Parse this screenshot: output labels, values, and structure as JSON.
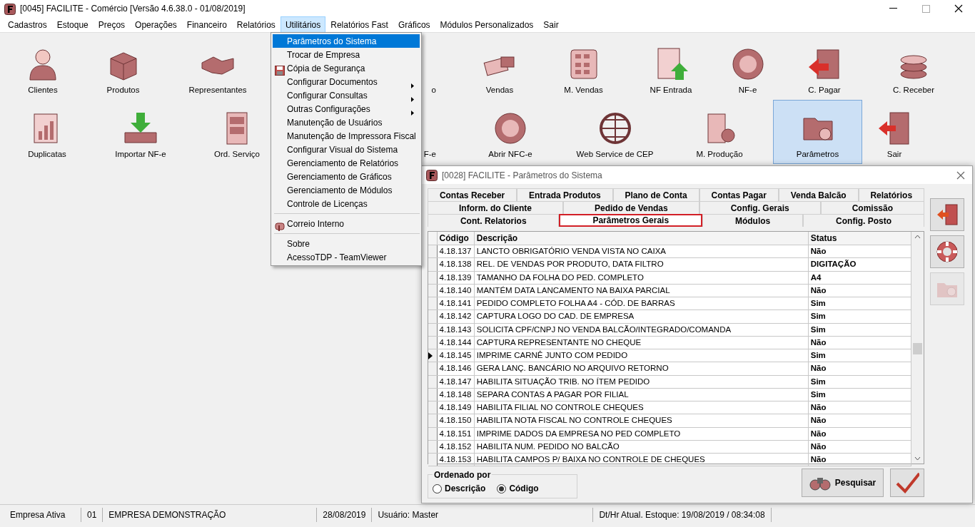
{
  "window": {
    "title": "[0045] FACILITE - Comércio [Versão 4.6.38.0 - 01/08/2019]"
  },
  "menu_bar": [
    {
      "label": "Cadastros",
      "selected": false
    },
    {
      "label": "Estoque",
      "selected": false
    },
    {
      "label": "Preços",
      "selected": false
    },
    {
      "label": "Operações",
      "selected": false
    },
    {
      "label": "Financeiro",
      "selected": false
    },
    {
      "label": "Relatórios",
      "selected": false
    },
    {
      "label": "Utilitários",
      "selected": true
    },
    {
      "label": "Relatórios Fast",
      "selected": false
    },
    {
      "label": "Gráficos",
      "selected": false
    },
    {
      "label": "Módulos Personalizados",
      "selected": false
    },
    {
      "label": "Sair",
      "selected": false
    }
  ],
  "dropdown": [
    {
      "kind": "item",
      "label": "Parâmetros do Sistema",
      "selected": true,
      "submenu": false
    },
    {
      "kind": "item",
      "label": "Trocar de Empresa",
      "selected": false,
      "submenu": false
    },
    {
      "kind": "floppy",
      "label": "Cópia de Segurança",
      "selected": false,
      "submenu": false
    },
    {
      "kind": "item",
      "label": "Configurar Documentos",
      "selected": false,
      "submenu": true
    },
    {
      "kind": "item",
      "label": "Configurar Consultas",
      "selected": false,
      "submenu": true
    },
    {
      "kind": "item",
      "label": "Outras Configurações",
      "selected": false,
      "submenu": true
    },
    {
      "kind": "item",
      "label": "Manutenção de Usuários",
      "selected": false,
      "submenu": false
    },
    {
      "kind": "item",
      "label": "Manutenção de Impressora Fiscal",
      "selected": false,
      "submenu": false
    },
    {
      "kind": "item",
      "label": "Configurar Visual do Sistema",
      "selected": false,
      "submenu": false
    },
    {
      "kind": "item",
      "label": "Gerenciamento de Relatórios",
      "selected": false,
      "submenu": false
    },
    {
      "kind": "item",
      "label": "Gerenciamento de Gráficos",
      "selected": false,
      "submenu": false
    },
    {
      "kind": "item",
      "label": "Gerenciamento de Módulos",
      "selected": false,
      "submenu": false
    },
    {
      "kind": "item",
      "label": "Controle de Licenças",
      "selected": false,
      "submenu": false
    },
    {
      "kind": "separator"
    },
    {
      "kind": "mailbox",
      "label": "Correio Interno",
      "selected": false,
      "submenu": false
    },
    {
      "kind": "separator"
    },
    {
      "kind": "item",
      "label": "Sobre",
      "selected": false,
      "submenu": false
    },
    {
      "kind": "item",
      "label": "AcessoTDP - TeamViewer",
      "selected": false,
      "submenu": false
    }
  ],
  "desktop": [
    [
      {
        "kind": "person",
        "label": "Clientes",
        "selected": false
      },
      {
        "kind": "box",
        "label": "Produtos",
        "selected": false
      },
      {
        "kind": "handshake",
        "label": "Representantes",
        "selected": false
      },
      {
        "kind": "partial",
        "label": "o",
        "selected": false
      },
      {
        "kind": "cash",
        "label": "Vendas",
        "selected": false
      },
      {
        "kind": "calculator",
        "label": "M. Vendas",
        "selected": false
      },
      {
        "kind": "document",
        "label": "NF Entrada",
        "selected": false
      },
      {
        "kind": "badge",
        "label": "NF-e",
        "selected": false
      },
      {
        "kind": "bill",
        "label": "C. Pagar",
        "selected": false
      },
      {
        "kind": "coins",
        "label": "C. Receber",
        "selected": false
      }
    ],
    [
      {
        "kind": "chart",
        "label": "Duplicatas",
        "selected": false
      },
      {
        "kind": "tray",
        "label": "Importar NF-e",
        "selected": false
      },
      {
        "kind": "cabinet",
        "label": "Ord. Serviço",
        "selected": false
      },
      {
        "kind": "partial",
        "label": "F-e",
        "selected": false
      },
      {
        "kind": "badge",
        "label": "Abrir NFC-e",
        "selected": false
      },
      {
        "kind": "globe",
        "label": "Web Service de CEP",
        "selected": false
      },
      {
        "kind": "machine",
        "label": "M. Produção",
        "selected": false
      },
      {
        "kind": "folder",
        "label": "Parâmetros",
        "selected": true
      },
      {
        "kind": "door",
        "label": "Sair",
        "selected": false
      }
    ]
  ],
  "dialog": {
    "title": "[0028] FACILITE - Parâmetros do Sistema",
    "tabs": [
      [
        {
          "label": "Contas Receber",
          "selected": false
        },
        {
          "label": "Entrada Produtos",
          "selected": false
        },
        {
          "label": "Plano de Conta",
          "selected": false
        },
        {
          "label": "Contas Pagar",
          "selected": false
        },
        {
          "label": "Venda Balcão",
          "selected": false
        },
        {
          "label": "Relatórios",
          "selected": false
        }
      ],
      [
        {
          "label": "Inform. do Cliente",
          "selected": false
        },
        {
          "label": "Pedido de Vendas",
          "selected": false
        },
        {
          "label": "Config. Gerais",
          "selected": false
        },
        {
          "label": "Comissão",
          "selected": false
        }
      ],
      [
        {
          "label": "Cont. Relatorios",
          "selected": false
        },
        {
          "label": "Parâmetros Gerais",
          "selected": true
        },
        {
          "label": "Módulos",
          "selected": false
        },
        {
          "label": "Config. Posto",
          "selected": false
        }
      ]
    ],
    "table": {
      "columns": [
        "Código",
        "Descrição",
        "Status"
      ],
      "rows": [
        {
          "code": "4.18.137",
          "description": "LANCTO OBRIGATÓRIO VENDA VISTA NO CAIXA",
          "status": "Não",
          "selected": false
        },
        {
          "code": "4.18.138",
          "description": "REL. DE VENDAS POR PRODUTO, DATA FILTRO",
          "status": "DIGITAÇÃO",
          "selected": false
        },
        {
          "code": "4.18.139",
          "description": "TAMANHO DA FOLHA DO PED. COMPLETO",
          "status": "A4",
          "selected": false
        },
        {
          "code": "4.18.140",
          "description": "MANTÉM DATA LANCAMENTO NA BAIXA PARCIAL",
          "status": "Não",
          "selected": false
        },
        {
          "code": "4.18.141",
          "description": "PEDIDO COMPLETO FOLHA A4 - CÓD. DE BARRAS",
          "status": "Sim",
          "selected": false
        },
        {
          "code": "4.18.142",
          "description": "CAPTURA LOGO DO CAD. DE EMPRESA",
          "status": "Sim",
          "selected": false
        },
        {
          "code": "4.18.143",
          "description": "SOLICITA CPF/CNPJ NO VENDA BALCÃO/INTEGRADO/COMANDA",
          "status": "Sim",
          "selected": false
        },
        {
          "code": "4.18.144",
          "description": "CAPTURA REPRESENTANTE NO CHEQUE",
          "status": "Não",
          "selected": false
        },
        {
          "code": "4.18.145",
          "description": "IMPRIME CARNÊ JUNTO COM PEDIDO",
          "status": "Sim",
          "selected": true
        },
        {
          "code": "4.18.146",
          "description": "GERA LANÇ. BANCÁRIO NO ARQUIVO RETORNO",
          "status": "Não",
          "selected": false
        },
        {
          "code": "4.18.147",
          "description": "HABILITA SITUAÇÃO TRIB. NO ÍTEM PEDIDO",
          "status": "Sim",
          "selected": false
        },
        {
          "code": "4.18.148",
          "description": "SEPARA CONTAS A PAGAR POR FILIAL",
          "status": "Sim",
          "selected": false
        },
        {
          "code": "4.18.149",
          "description": "HABILITA FILIAL NO CONTROLE CHEQUES",
          "status": "Não",
          "selected": false
        },
        {
          "code": "4.18.150",
          "description": "HABILITA NOTA FISCAL NO CONTROLE CHEQUES",
          "status": "Não",
          "selected": false
        },
        {
          "code": "4.18.151",
          "description": "IMPRIME DADOS DA EMPRESA NO PED COMPLETO",
          "status": "Não",
          "selected": false
        },
        {
          "code": "4.18.152",
          "description": "HABILITA NUM. PEDIDO NO BALCÃO",
          "status": "Não",
          "selected": false
        },
        {
          "code": "4.18.153",
          "description": "HABILITA CAMPOS P/ BAIXA NO CONTROLE DE CHEQUES",
          "status": "Não",
          "selected": false
        }
      ]
    },
    "sort": {
      "label": "Ordenado por",
      "options": [
        {
          "label": "Descrição",
          "selected": false
        },
        {
          "label": "Código",
          "selected": true
        }
      ]
    },
    "search_button": "Pesquisar",
    "side_buttons": [
      {
        "kind": "exit",
        "disabled": false
      },
      {
        "kind": "help",
        "disabled": false
      },
      {
        "kind": "settings",
        "disabled": true
      }
    ]
  },
  "status_bar": [
    "Empresa Ativa",
    "01",
    "EMPRESA DEMONSTRAÇÃO",
    "28/08/2019",
    "Usuário: Master",
    "Dt/Hr Atual. Estoque: 19/08/2019 / 08:34:08"
  ]
}
